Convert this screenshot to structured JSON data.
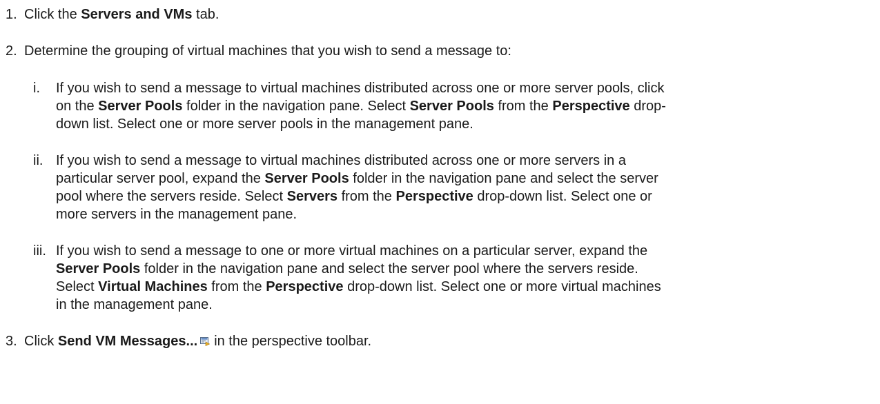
{
  "steps": [
    {
      "number": "1.",
      "pre": "Click the ",
      "bold": "Servers and VMs",
      "post": " tab."
    },
    {
      "number": "2.",
      "text": "Determine the grouping of virtual machines that you wish to send a message to:"
    },
    {
      "number": "3.",
      "pre": "Click ",
      "bold": "Send VM Messages...",
      "icon": "send-vm-messages-icon",
      "post": "in the perspective toolbar."
    }
  ],
  "substeps": [
    {
      "number": "i.",
      "lines": [
        [
          {
            "t": "If you wish to send a message to virtual machines distributed across one or more server pools, click"
          }
        ],
        [
          {
            "t": "on the "
          },
          {
            "b": "Server Pools"
          },
          {
            "t": " folder in the navigation pane. Select "
          },
          {
            "b": "Server Pools"
          },
          {
            "t": " from the "
          },
          {
            "b": "Perspective"
          },
          {
            "t": " drop-"
          }
        ],
        [
          {
            "t": "down list. Select one or more server pools in the management pane."
          }
        ]
      ]
    },
    {
      "number": "ii.",
      "lines": [
        [
          {
            "t": "If you wish to send a message to virtual machines distributed across one or more servers in a"
          }
        ],
        [
          {
            "t": "particular server pool, expand the "
          },
          {
            "b": "Server Pools"
          },
          {
            "t": " folder in the navigation pane and select the server"
          }
        ],
        [
          {
            "t": "pool where the servers reside. Select "
          },
          {
            "b": "Servers"
          },
          {
            "t": " from the "
          },
          {
            "b": "Perspective"
          },
          {
            "t": " drop-down list. Select one or"
          }
        ],
        [
          {
            "t": "more servers in the management pane."
          }
        ]
      ]
    },
    {
      "number": "iii.",
      "lines": [
        [
          {
            "t": "If you wish to send a message to one or more virtual machines on a particular server, expand the"
          }
        ],
        [
          {
            "b": "Server Pools"
          },
          {
            "t": " folder in the navigation pane and select the server pool where the servers reside."
          }
        ],
        [
          {
            "t": "Select "
          },
          {
            "b": "Virtual Machines"
          },
          {
            "t": " from the "
          },
          {
            "b": "Perspective"
          },
          {
            "t": " drop-down list. Select one or more virtual machines"
          }
        ],
        [
          {
            "t": "in the management pane."
          }
        ]
      ]
    }
  ]
}
